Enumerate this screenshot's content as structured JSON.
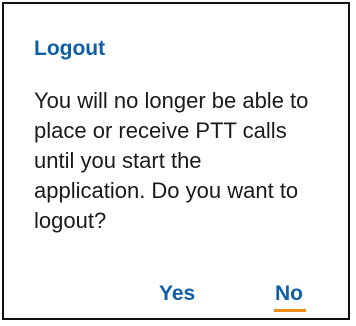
{
  "dialog": {
    "title": "Logout",
    "message_lines": [
      "You will no longer be able to",
      "place or receive PTT calls",
      "until you start the",
      "application. Do you want to",
      "logout?"
    ],
    "buttons": {
      "yes_label": "Yes",
      "no_label": "No"
    },
    "focused_button": "No",
    "colors": {
      "accent": "#0f5ea8",
      "focus_underline": "#f28c18",
      "text": "#1a1a1a",
      "border": "#111111"
    }
  }
}
